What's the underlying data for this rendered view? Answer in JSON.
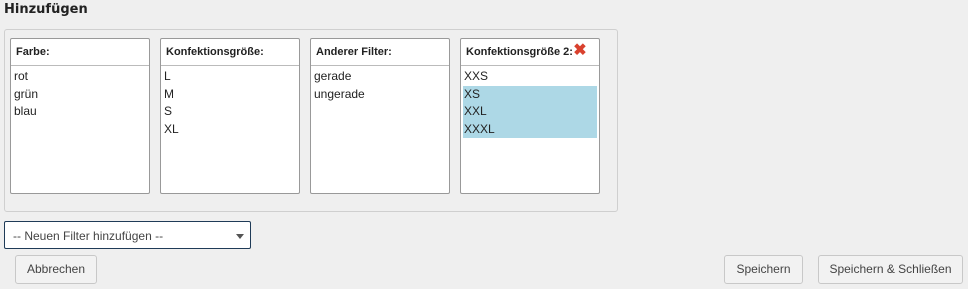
{
  "page": {
    "title": "Hinzufügen"
  },
  "filters": [
    {
      "header": "Farbe:",
      "options": [
        {
          "label": "rot",
          "selected": false
        },
        {
          "label": "grün",
          "selected": false
        },
        {
          "label": "blau",
          "selected": false
        }
      ]
    },
    {
      "header": "Konfektionsgröße:",
      "options": [
        {
          "label": "L",
          "selected": false
        },
        {
          "label": "M",
          "selected": false
        },
        {
          "label": "S",
          "selected": false
        },
        {
          "label": "XL",
          "selected": false
        }
      ]
    },
    {
      "header": "Anderer Filter:",
      "options": [
        {
          "label": "gerade",
          "selected": false
        },
        {
          "label": "ungerade",
          "selected": false
        }
      ]
    },
    {
      "header": "Konfektionsgröße 2:",
      "removable": true,
      "remove_icon": "close-x-icon",
      "options": [
        {
          "label": "XXS",
          "selected": false
        },
        {
          "label": "XS",
          "selected": true
        },
        {
          "label": "XXL",
          "selected": true
        },
        {
          "label": "XXXL",
          "selected": true
        }
      ]
    }
  ],
  "add_filter": {
    "value": "-- Neuen Filter hinzufügen --"
  },
  "buttons": {
    "cancel": "Abbrechen",
    "save": "Speichern",
    "save_close": "Speichern & Schließen"
  },
  "colors": {
    "selection": "#add8e6",
    "remove": "#d9412e"
  }
}
